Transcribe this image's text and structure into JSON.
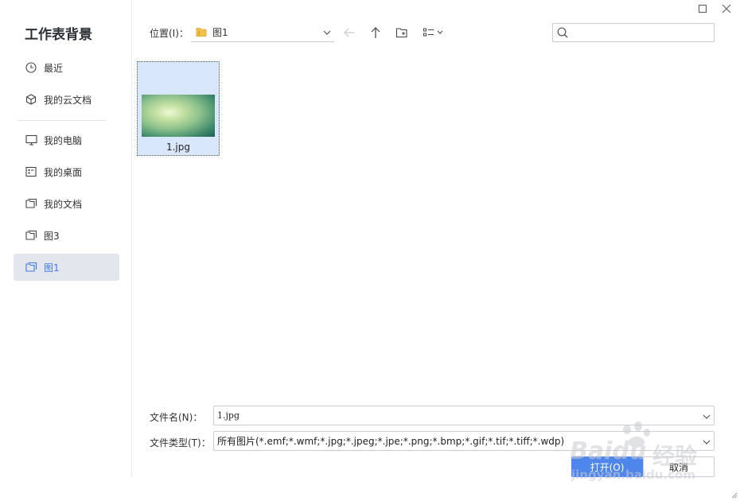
{
  "dialog": {
    "title": "工作表背景"
  },
  "sidebar": {
    "items": [
      {
        "label": "最近",
        "icon": "clock-icon"
      },
      {
        "label": "我的云文档",
        "icon": "cube-icon"
      },
      {
        "label": "我的电脑",
        "icon": "monitor-icon"
      },
      {
        "label": "我的桌面",
        "icon": "desktop-icon"
      },
      {
        "label": "我的文档",
        "icon": "folder-icon"
      },
      {
        "label": "图3",
        "icon": "folder-icon"
      },
      {
        "label": "图1",
        "icon": "folder-icon",
        "active": true
      }
    ]
  },
  "toolbar": {
    "location_label": "位置(I)：",
    "location_value": "图1",
    "search_placeholder": ""
  },
  "files": [
    {
      "name": "1.jpg",
      "selected": true
    }
  ],
  "form": {
    "filename_label": "文件名(N)：",
    "filename_value": "1.jpg",
    "filetype_label": "文件类型(T)：",
    "filetype_value": "所有图片(*.emf;*.wmf;*.jpg;*.jpeg;*.jpe;*.png;*.bmp;*.gif;*.tif;*.tiff;*.wdp)"
  },
  "buttons": {
    "open_label": "打开(O)",
    "cancel_label": "取消"
  },
  "watermark": {
    "brand": "Baidu",
    "cn": "经验",
    "url": "jingyan.baidu.com"
  },
  "colors": {
    "accent": "#4f86ec",
    "active_text": "#3f7ae8",
    "selected_bg": "#d9e7fb",
    "sidebar_active_bg": "#e3e6ed"
  }
}
